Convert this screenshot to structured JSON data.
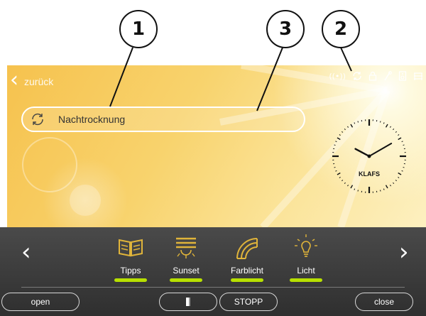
{
  "callouts": [
    {
      "number": "1"
    },
    {
      "number": "2"
    },
    {
      "number": "3"
    }
  ],
  "header": {
    "back_label": "zurück",
    "status_icons": [
      "radio-signal-icon",
      "sync-icon",
      "lock-icon",
      "wrench-icon",
      "speaker-icon",
      "sauna-bench-icon"
    ]
  },
  "program": {
    "label": "Nachtrocknung",
    "icon": "sync-icon"
  },
  "clock": {
    "brand": "KLAFS",
    "hour_hand_deg": 298,
    "minute_hand_deg": 60
  },
  "function_bar": {
    "tiles": [
      {
        "label": "Tipps",
        "icon": "book-icon"
      },
      {
        "label": "Sunset",
        "icon": "sunset-icon"
      },
      {
        "label": "Farblicht",
        "icon": "rainbow-icon"
      },
      {
        "label": "Licht",
        "icon": "lightbulb-icon"
      }
    ],
    "accent_color": "#b7e000"
  },
  "controls": {
    "open_label": "open",
    "door_icon": "door-icon",
    "stop_label": "STOPP",
    "close_label": "close"
  },
  "colors": {
    "panel_yellow": "#f8d36d",
    "bar_dark": "#3a3a3a",
    "icon_gold": "#e0b43a"
  }
}
